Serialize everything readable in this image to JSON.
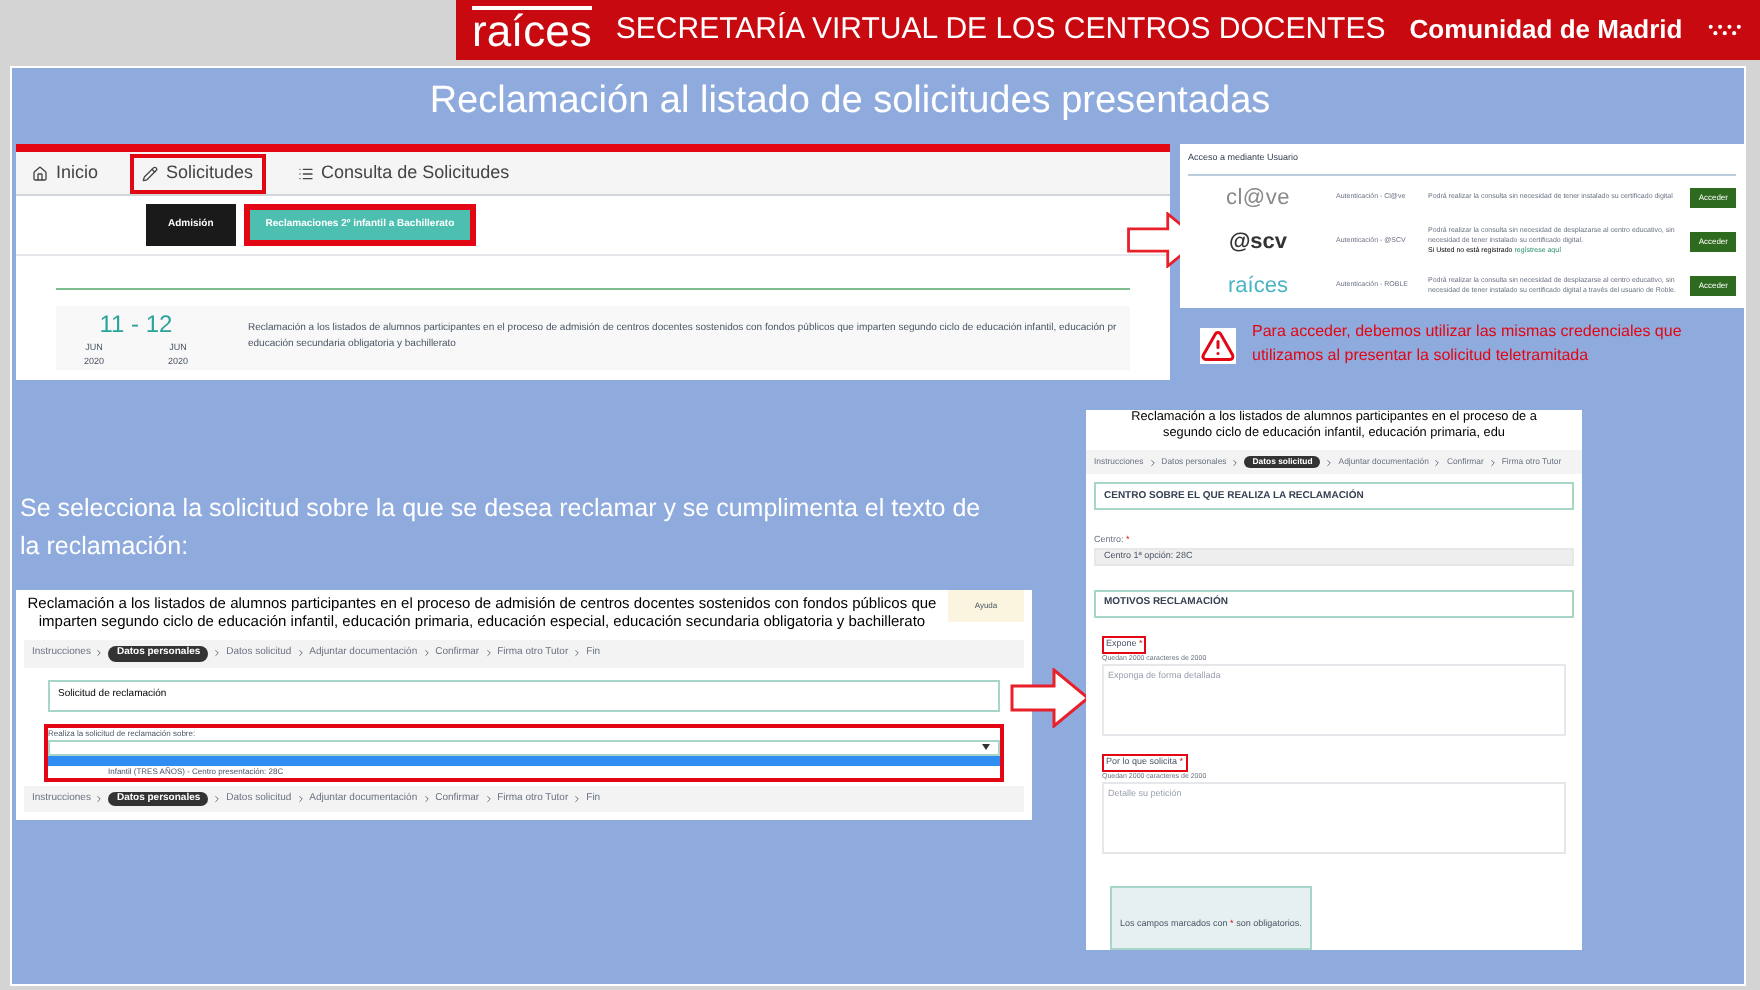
{
  "header": {
    "logo": "raíces",
    "title": "SECRETARÍA VIRTUAL DE LOS CENTROS DOCENTES",
    "region": "Comunidad de Madrid"
  },
  "slide_title": "Reclamación al listado de solicitudes presentadas",
  "portal": {
    "tabs": [
      {
        "label": "Inicio",
        "highlighted": false
      },
      {
        "label": "Solicitudes",
        "highlighted": true
      },
      {
        "label": "Consulta de Solicitudes",
        "highlighted": false
      }
    ],
    "buttons": [
      {
        "label": "Admisión",
        "color": "#1a1a1a",
        "highlighted": false
      },
      {
        "label": "Reclamaciones 2º infantil a Bachillerato",
        "color": "#4dbfb1",
        "highlighted": true
      }
    ],
    "date_range": "11 - 12",
    "months": [
      "JUN",
      "JUN"
    ],
    "years": [
      "2020",
      "2020"
    ],
    "description": "Reclamación a los listados de alumnos participantes en el proceso de admisión de centros docentes sostenidos con fondos públicos que imparten segundo ciclo de educación infantil, educación pr educación secundaria obligatoria y bachillerato"
  },
  "login": {
    "heading": "Acceso a mediante Usuario",
    "methods": [
      {
        "kind": "clave",
        "logo": "cl@ve",
        "name": "Autenticación - Cl@ve",
        "description": "Podrá realizar la consulta sin necesidad de tener instalado su certificado digital",
        "button": "Acceder"
      },
      {
        "kind": "scv",
        "logo": "@scv",
        "name": "Autenticación - @SCV",
        "description": "Podrá realizar la consulta sin necesidad de desplazarse al centro educativo, sin necesidad de tener instalado su certificado digital.",
        "note": "Si Usted no está registrado",
        "link": "regístrese aquí",
        "button": "Acceder"
      },
      {
        "kind": "raices",
        "logo": "raíces",
        "name": "Autenticación - ROBLE",
        "description": "Podrá realizar la consulta sin necesidad de desplazarse al centro educativo, sin necesidad de tener instalado su certificado digital a través del usuario de Roble.",
        "button": "Acceder"
      }
    ]
  },
  "warning": "Para acceder, debemos utilizar las mismas credenciales que utilizamos al presentar la solicitud teletramitada",
  "instruction": "Se selecciona la solicitud sobre la que se desea reclamar y se cumplimenta el texto de la reclamación:",
  "form_a": {
    "title": "Reclamación a los listados de alumnos participantes en el proceso de admisión de centros docentes sostenidos con fondos públicos que imparten segundo ciclo de educación infantil, educación primaria, educación especial, educación secundaria obligatoria y bachillerato",
    "help": "Ayuda",
    "steps": [
      {
        "label": "Instrucciones",
        "selected": false
      },
      {
        "label": "Datos personales",
        "selected": true
      },
      {
        "label": "Datos solicitud",
        "selected": false
      },
      {
        "label": "Adjuntar documentación",
        "selected": false
      },
      {
        "label": "Confirmar",
        "selected": false
      },
      {
        "label": "Firma otro Tutor",
        "selected": false
      },
      {
        "label": "Fin",
        "selected": false
      }
    ],
    "panel_title": "Solicitud de reclamación",
    "field_label": "Realiza la solicitud de reclamación sobre:",
    "option": "Infantil (TRES AÑOS) - Centro presentación: 28C",
    "highlighted": true,
    "steps_bottom": [
      {
        "label": "Instrucciones",
        "selected": false
      },
      {
        "label": "Datos personales",
        "selected": true
      },
      {
        "label": "Datos solicitud",
        "selected": false
      },
      {
        "label": "Adjuntar documentación",
        "selected": false
      },
      {
        "label": "Confirmar",
        "selected": false
      },
      {
        "label": "Firma otro Tutor",
        "selected": false
      },
      {
        "label": "Fin",
        "selected": false
      }
    ]
  },
  "form_b": {
    "title_lines": [
      "Reclamación a los listados de alumnos participantes en el proceso de a",
      "segundo ciclo de educación infantil, educación primaria, edu"
    ],
    "steps": [
      {
        "label": "Instrucciones",
        "selected": false
      },
      {
        "label": "Datos personales",
        "selected": false
      },
      {
        "label": "Datos solicitud",
        "selected": true
      },
      {
        "label": "Adjuntar documentación",
        "selected": false
      },
      {
        "label": "Confirmar",
        "selected": false
      },
      {
        "label": "Firma otro Tutor",
        "selected": false
      }
    ],
    "section_1": "CENTRO SOBRE EL QUE REALIZA LA RECLAMACIÓN",
    "centro_label": "Centro:",
    "centro_mark": "*",
    "centro_value": "Centro 1ª opción: 28C",
    "section_2": "MOTIVOS RECLAMACIÓN",
    "fields": [
      {
        "label": "Expone",
        "mark": "*",
        "counter": "Quedan 2000 caracteres de 2000",
        "placeholder": "Exponga de forma detallada",
        "highlighted": true
      },
      {
        "label": "Por lo que solicita",
        "mark": "*",
        "counter": "Quedan 2000 caracteres de 2000",
        "placeholder": "Detalle su petición",
        "highlighted": true
      }
    ],
    "note_before": "Los campos marcados con",
    "note_mark": "*",
    "note_after": "son obligatorios."
  }
}
